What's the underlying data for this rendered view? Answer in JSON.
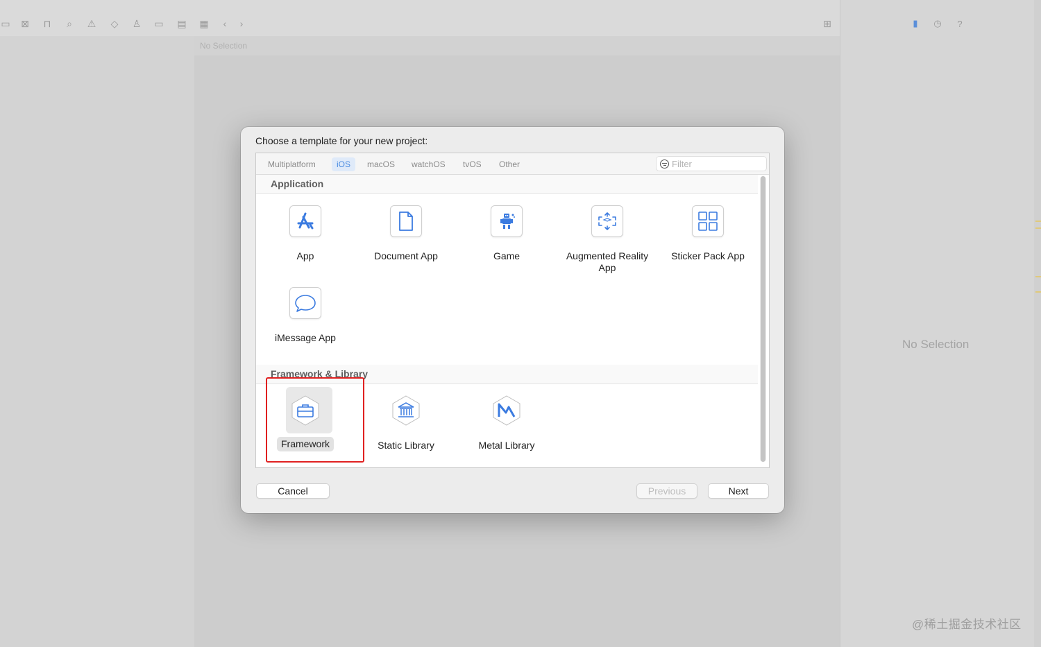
{
  "background": {
    "nav_title": "No Selection",
    "inspector_placeholder": "No Selection",
    "watermark": "@稀土掘金技术社区"
  },
  "dialog": {
    "title": "Choose a template for your new project:",
    "tabs": [
      {
        "label": "Multiplatform",
        "active": false
      },
      {
        "label": "iOS",
        "active": true
      },
      {
        "label": "macOS",
        "active": false
      },
      {
        "label": "watchOS",
        "active": false
      },
      {
        "label": "tvOS",
        "active": false
      },
      {
        "label": "Other",
        "active": false
      }
    ],
    "filter": {
      "placeholder": "Filter",
      "value": ""
    },
    "sections": [
      {
        "title": "Application",
        "items": [
          {
            "label": "App",
            "icon": "app-store-icon"
          },
          {
            "label": "Document App",
            "icon": "document-icon"
          },
          {
            "label": "Game",
            "icon": "game-robot-icon"
          },
          {
            "label": "Augmented Reality App",
            "icon": "ar-cube-icon"
          },
          {
            "label": "Sticker Pack App",
            "icon": "grid-icon"
          },
          {
            "label": "iMessage App",
            "icon": "chat-bubble-icon"
          }
        ]
      },
      {
        "title": "Framework & Library",
        "items": [
          {
            "label": "Framework",
            "icon": "toolbox-icon",
            "selected": true
          },
          {
            "label": "Static Library",
            "icon": "library-building-icon"
          },
          {
            "label": "Metal Library",
            "icon": "metal-icon"
          }
        ]
      }
    ],
    "buttons": {
      "cancel": "Cancel",
      "previous": "Previous",
      "next": "Next"
    }
  },
  "colors": {
    "accent": "#4a8be0",
    "highlight": "#e02020"
  }
}
